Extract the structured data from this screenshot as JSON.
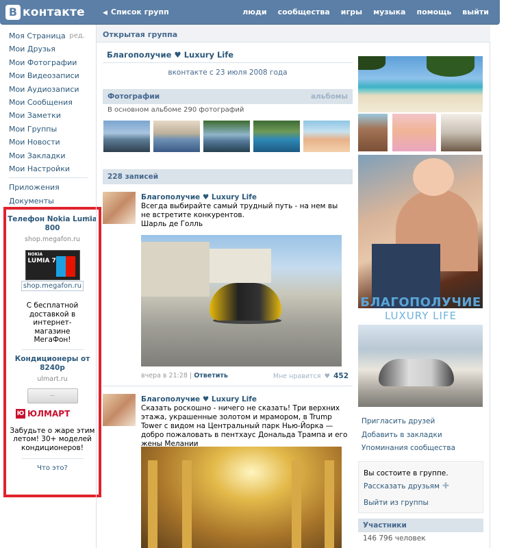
{
  "header": {
    "logo_letter": "В",
    "logo_text": "контакте",
    "back_link": "Список групп",
    "nav": [
      "люди",
      "сообщества",
      "игры",
      "музыка",
      "помощь",
      "выйти"
    ]
  },
  "left_menu": {
    "items": [
      "Моя Страница",
      "Мои Друзья",
      "Мои Фотографии",
      "Мои Видеозаписи",
      "Мои Аудиозаписи",
      "Мои Сообщения",
      "Мои Заметки",
      "Мои Группы",
      "Мои Новости",
      "Мои Закладки",
      "Мои Настройки"
    ],
    "edit_label": "ред.",
    "extra": [
      "Приложения",
      "Документы"
    ]
  },
  "ads": {
    "close": "×",
    "ad1": {
      "title": "Телефон Nokia Lumia 800",
      "domain": "shop.megafon.ru",
      "image_brand": "NOKIA",
      "image_model": "LUMIA 710",
      "link": "shop.megafon.ru",
      "text": "С бесплатной доставкой в интернет-магазине МегаФон!"
    },
    "ad2": {
      "title": "Кондиционеры от 8240р",
      "domain": "ulmart.ru",
      "ac_label": "...",
      "brand_mark": "Ю",
      "brand": "ЮЛМАРТ",
      "text": "Забудьте о жаре этим летом! 30+ моделей кондиционеров!"
    },
    "what_is": "Что это?"
  },
  "group": {
    "type": "Открытая группа",
    "name": "Благополучие ♥ Luxury Life",
    "since": "вконтакте с 23 июля 2008 года"
  },
  "photos": {
    "title": "Фотографии",
    "albums_link": "альбомы",
    "info": "В основном альбоме 290 фотографий"
  },
  "wall": {
    "count_label": "228 записей",
    "posts": [
      {
        "author": "Благополучие ♥ Luxury Life",
        "text": "Всегда выбирайте самый трудный путь - на нем вы не встретите конкурентов.\nШарль де Голль",
        "time": "вчера в 21:28",
        "reply": "Ответить",
        "like_label": "Мне нравится",
        "likes": "452"
      },
      {
        "author": "Благополучие ♥ Luxury Life",
        "text": "Сказать роскошно - ничего не сказать! Три верхних этажа, украшенные золотом и мрамором, в Trump Tower с видом на Центральный парк Нью-Йорка — добро пожаловать в пентхаус Дональда Трампа и его жены Мелании"
      }
    ]
  },
  "right": {
    "brand_line1": "БЛАГОПОЛУЧИЕ",
    "brand_line2": "LUXURY LIFE",
    "links": [
      "Пригласить друзей",
      "Добавить в закладки",
      "Упоминания сообщества"
    ],
    "member_status": "Вы состоите в группе.",
    "tell_friends": "Рассказать друзьям",
    "leave": "Выйти из группы",
    "members_title": "Участники",
    "members_count": "146 796 человек"
  },
  "colors": {
    "header_bg": "#5b7fa6",
    "link": "#2b587a",
    "bar_bg": "#dae2ea",
    "ad_frame": "#e0222d"
  }
}
